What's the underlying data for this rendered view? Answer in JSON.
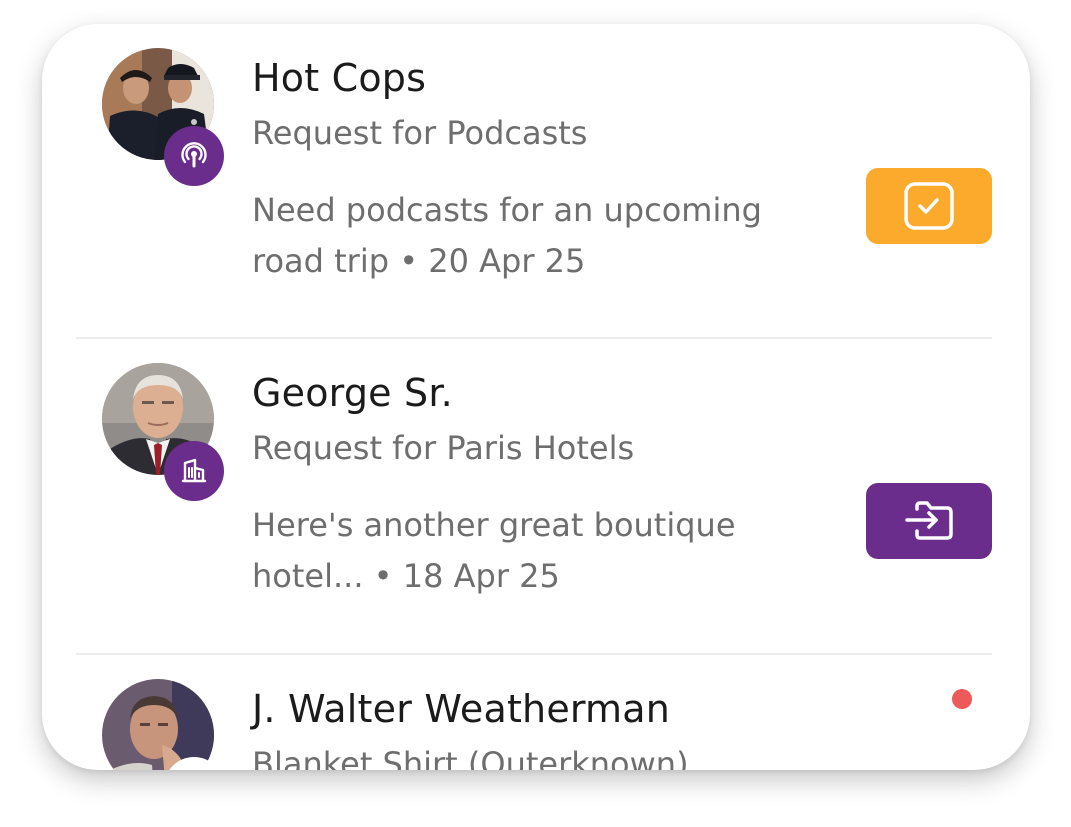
{
  "theme": {
    "brand_purple": "#6b2d8c",
    "accent_orange": "#fbaa2c",
    "unread_red": "#ee5a5a"
  },
  "conversations": [
    {
      "name": "Hot Cops",
      "subtitle": "Request for Podcasts",
      "message": "Need podcasts for an upcoming road trip",
      "date": "20 Apr 25",
      "category_icon": "podcast-icon",
      "action_icon": "checkbox-check-icon",
      "action_color": "#fbaa2c"
    },
    {
      "name": "George Sr.",
      "subtitle": "Request for Paris Hotels",
      "message": "Here's another great boutique hotel...",
      "date": "18 Apr 25",
      "category_icon": "building-icon",
      "action_icon": "folder-import-icon",
      "action_color": "#6b2d8c"
    },
    {
      "name": "J. Walter Weatherman",
      "subtitle": "Blanket Shirt (Outerknown)",
      "unread": true
    }
  ]
}
